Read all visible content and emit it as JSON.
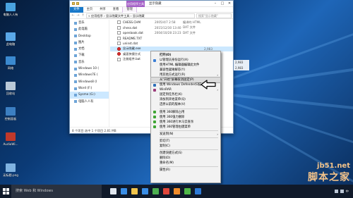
{
  "desktop": {
    "icons": [
      {
        "label": "电脑人人有",
        "color": "#4aa3df"
      },
      {
        "label": "此电脑",
        "color": "#5aa8e8"
      },
      {
        "label": "网络",
        "color": "#3b8ad0"
      },
      {
        "label": "回收站",
        "color": "#b9c9d8"
      },
      {
        "label": "控制面板",
        "color": "#3c7fc2"
      },
      {
        "label": "AudioWi...",
        "color": "#c0392b"
      },
      {
        "label": "无标题.png",
        "color": "#7fb2e0"
      }
    ]
  },
  "window": {
    "context_tab": "应用程序工具",
    "title": "显示隐藏",
    "ribbon_tabs": [
      "文件",
      "主页",
      "共享",
      "查看",
      "管理"
    ],
    "address": "« 应用程序 › 显示隐藏文件工具 › 显示隐藏",
    "search_placeholder": "搜索\"显示隐藏\"",
    "nav_items": [
      {
        "label": "音乐",
        "selected": false
      },
      {
        "label": "此电脑",
        "selected": false
      },
      {
        "label": "Desktop",
        "selected": false
      },
      {
        "label": "图片",
        "selected": false
      },
      {
        "label": "文档",
        "selected": false
      },
      {
        "label": "下载",
        "selected": false
      },
      {
        "label": "音乐",
        "selected": false
      },
      {
        "label": "Windows 10 (",
        "selected": false
      },
      {
        "label": "Windows7E (",
        "selected": false
      },
      {
        "label": "Windows8 (I",
        "selected": false
      },
      {
        "label": "Word (F:)",
        "selected": false
      },
      {
        "label": "Sysme (G:)",
        "selected": true
      },
      {
        "label": "电脑人人有",
        "selected": false
      }
    ],
    "files": [
      {
        "name": "CHESS.CHM",
        "date": "2005/4/7 2:58",
        "type": "编译的 HTML",
        "size": "",
        "red": false
      },
      {
        "name": "chess.dat",
        "date": "2015/12/30 13:40",
        "type": "DAT 文件",
        "size": "",
        "red": false
      },
      {
        "name": "openbook.dat",
        "date": "2004/10/28 23:23",
        "type": "DAT 文件",
        "size": "",
        "red": false
      },
      {
        "name": "README.TXT",
        "date": "",
        "type": "",
        "size": "",
        "red": false
      },
      {
        "name": "uninst.dat",
        "date": "",
        "type": "",
        "size": "",
        "red": false
      },
      {
        "name": "显示隐藏.exe",
        "date": "",
        "type": "",
        "size": "2,983",
        "red": true
      },
      {
        "name": "桌面快捷方式",
        "date": "",
        "type": "",
        "size": "2,983",
        "red": true
      },
      {
        "name": "注册组件.bat",
        "date": "",
        "type": "",
        "size": "",
        "red": false
      }
    ],
    "status": "8 个项目    选中 1 个项目  2.81 MB"
  },
  "context_menu": {
    "items": [
      {
        "label": "打开(O)",
        "bold": true,
        "icon": "",
        "arrow": false,
        "sep_after": false,
        "hl": false
      },
      {
        "label": "以管理员身份运行(A)",
        "bold": false,
        "icon": "#3b7fd6",
        "arrow": false,
        "sep_after": false,
        "hl": false
      },
      {
        "label": "使用HTML 编辑器编辑此文件",
        "bold": false,
        "icon": "",
        "arrow": false,
        "sep_after": false,
        "hl": false
      },
      {
        "label": "兼容性疑难解答(Y)",
        "bold": false,
        "icon": "",
        "arrow": false,
        "sep_after": false,
        "hl": false
      },
      {
        "label": "用其他方式运行(R)",
        "bold": false,
        "icon": "",
        "arrow": true,
        "sep_after": false,
        "hl": false
      },
      {
        "label": "从\"开始\"屏幕取消固定(P)",
        "bold": false,
        "icon": "",
        "arrow": false,
        "sep_after": false,
        "hl": true
      },
      {
        "label": "使用 Windows Defender扫描...",
        "bold": false,
        "icon": "#2d6fb8",
        "arrow": false,
        "sep_after": false,
        "hl": false
      },
      {
        "label": "WinRAR",
        "bold": false,
        "icon": "#9b3b7a",
        "arrow": true,
        "sep_after": false,
        "hl": false
      },
      {
        "label": "固定到任务栏(K)",
        "bold": false,
        "icon": "",
        "arrow": false,
        "sep_after": false,
        "hl": false
      },
      {
        "label": "添加到开始菜单(Q)",
        "bold": false,
        "icon": "",
        "arrow": false,
        "sep_after": false,
        "hl": false
      },
      {
        "label": "还原以前的版本(V)",
        "bold": false,
        "icon": "",
        "arrow": false,
        "sep_after": true,
        "hl": false
      },
      {
        "label": "使用 360解除占用",
        "bold": false,
        "icon": "#3fa535",
        "arrow": false,
        "sep_after": false,
        "hl": false
      },
      {
        "label": "使用 360强力删除",
        "bold": false,
        "icon": "#3fa535",
        "arrow": false,
        "sep_after": false,
        "hl": false
      },
      {
        "label": "使用 360进行木马云查杀",
        "bold": false,
        "icon": "#3fa535",
        "arrow": false,
        "sep_after": false,
        "hl": false
      },
      {
        "label": "使用 360管理右键菜单",
        "bold": false,
        "icon": "#3fa535",
        "arrow": false,
        "sep_after": true,
        "hl": false
      },
      {
        "label": "发送到(N)",
        "bold": false,
        "icon": "",
        "arrow": true,
        "sep_after": true,
        "hl": false
      },
      {
        "label": "剪切(T)",
        "bold": false,
        "icon": "",
        "arrow": false,
        "sep_after": false,
        "hl": false
      },
      {
        "label": "复制(C)",
        "bold": false,
        "icon": "",
        "arrow": false,
        "sep_after": true,
        "hl": false
      },
      {
        "label": "创建快捷方式(S)",
        "bold": false,
        "icon": "",
        "arrow": false,
        "sep_after": false,
        "hl": false
      },
      {
        "label": "删除(D)",
        "bold": false,
        "icon": "",
        "arrow": false,
        "sep_after": false,
        "hl": false
      },
      {
        "label": "重命名(M)",
        "bold": false,
        "icon": "",
        "arrow": false,
        "sep_after": true,
        "hl": false
      },
      {
        "label": "属性(R)",
        "bold": false,
        "icon": "",
        "arrow": false,
        "sep_after": false,
        "hl": false
      }
    ]
  },
  "taskbar": {
    "search_placeholder": "搜索 Web 和 Windows",
    "app_icons": [
      {
        "name": "task-view-icon",
        "color": "#dfe6ee"
      },
      {
        "name": "edge-icon",
        "color": "#3a8ee6"
      },
      {
        "name": "explorer-icon",
        "color": "#f0c44c"
      },
      {
        "name": "store-icon",
        "color": "#3a8ee6"
      },
      {
        "name": "chrome-icon",
        "color": "#4caf50"
      },
      {
        "name": "app-red-icon",
        "color": "#e0463a"
      },
      {
        "name": "app-orange-icon",
        "color": "#f08c2a"
      },
      {
        "name": "app-green-icon",
        "color": "#4fb848"
      },
      {
        "name": "app-blue-icon",
        "color": "#2d7ad6"
      }
    ],
    "tray_text": "中"
  },
  "watermark": {
    "line1": "jb51.net",
    "line2": "脚本之家"
  }
}
